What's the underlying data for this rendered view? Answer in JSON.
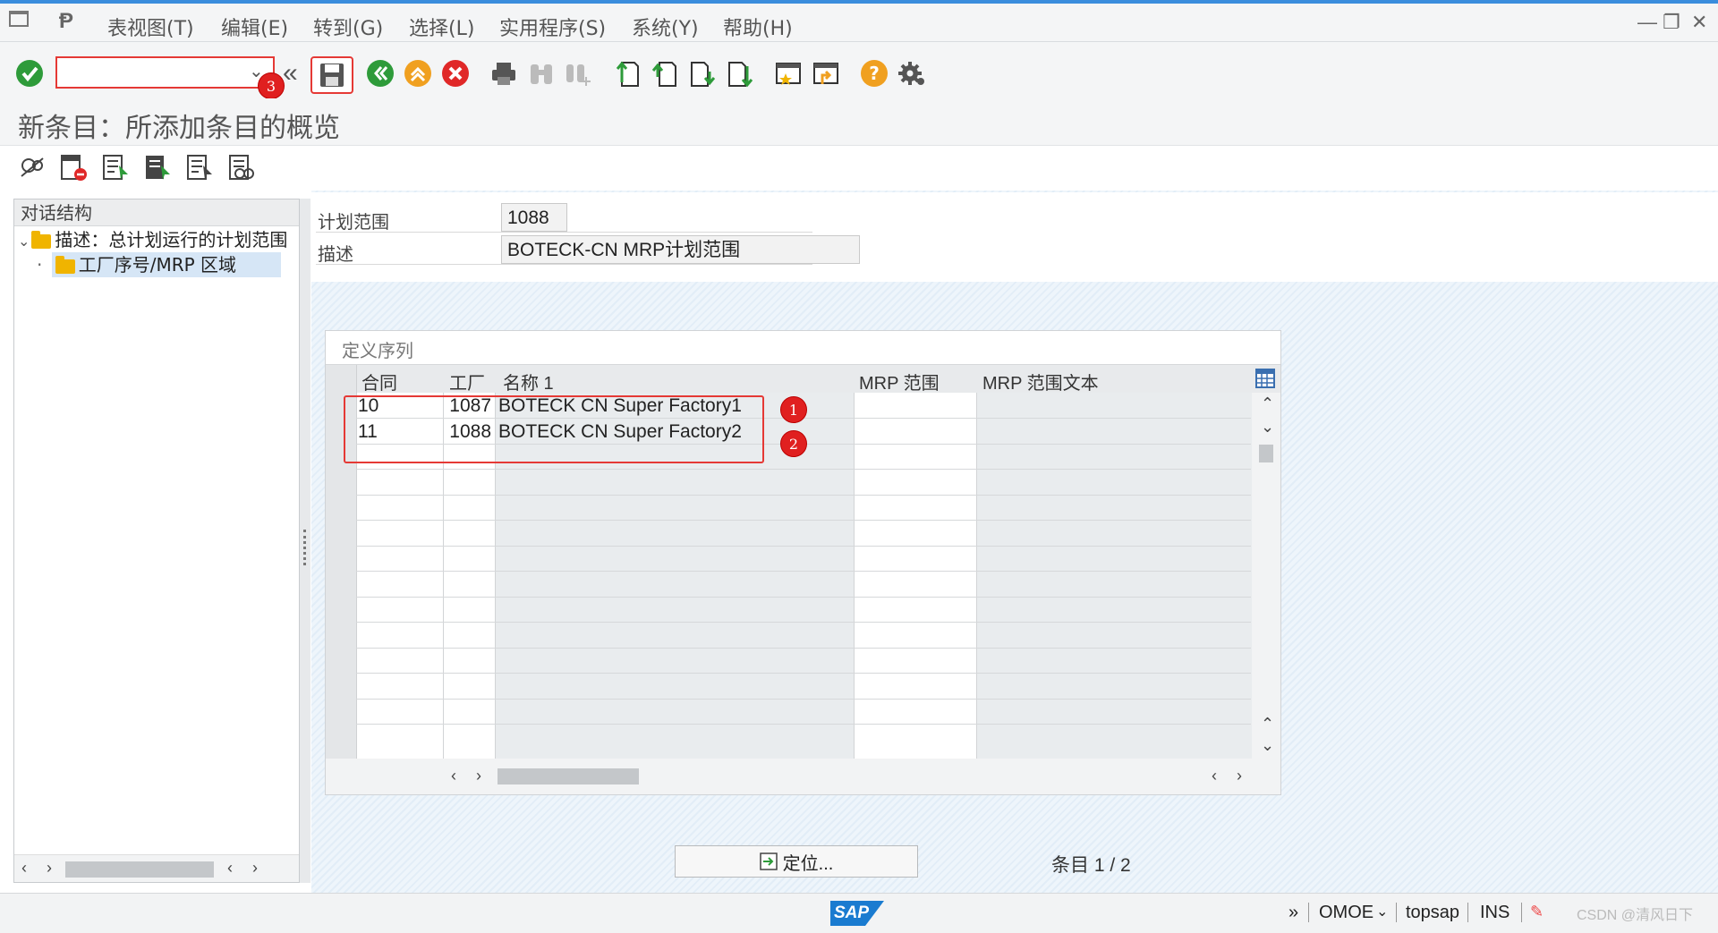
{
  "menu": {
    "items": [
      "表视图(T)",
      "编辑(E)",
      "转到(G)",
      "选择(L)",
      "实用程序(S)",
      "系统(Y)",
      "帮助(H)"
    ]
  },
  "toolbar": {
    "command_value": "",
    "icons": [
      "enter-icon",
      "back-icon",
      "save-icon",
      "back-green-icon",
      "exit-icon",
      "cancel-icon",
      "print-icon",
      "find-icon",
      "find-next-icon",
      "first-page-icon",
      "previous-page-icon",
      "next-page-icon",
      "last-page-icon",
      "new-session-icon",
      "shortcut-icon",
      "help-icon",
      "settings-icon"
    ]
  },
  "annotations": {
    "marker_1": "1",
    "marker_2": "2",
    "marker_3": "3"
  },
  "page": {
    "title": "新条目：所添加条目的概览"
  },
  "tree": {
    "header": "对话结构",
    "root_label": "描述：总计划运行的计划范围",
    "child_label": "工厂序号/MRP 区域"
  },
  "form": {
    "plan_scope_label": "计划范围",
    "plan_scope_value": "1088",
    "desc_label": "描述",
    "desc_value": "BOTECK-CN MRP计划范围"
  },
  "table": {
    "title": "定义序列",
    "columns": [
      "合同",
      "工厂",
      "名称 1",
      "MRP 范围",
      "MRP 范围文本"
    ],
    "rows": [
      {
        "seq": "10",
        "plant": "1087",
        "name": "BOTECK CN Super Factory1",
        "mrp": "",
        "mrp_text": ""
      },
      {
        "seq": "11",
        "plant": "1088",
        "name": "BOTECK CN Super Factory2",
        "mrp": "",
        "mrp_text": ""
      }
    ]
  },
  "footer": {
    "locate_label": "定位...",
    "entry_label": "条目",
    "entry_value": "1 / 2"
  },
  "status": {
    "logo": "SAP",
    "transaction": "OMOE",
    "server": "topsap",
    "mode": "INS",
    "watermark": "CSDN @清风日下"
  },
  "colors": {
    "accent": "#3a8ddd",
    "annotation_red": "#e02020",
    "tree_selected": "#d6e6f6"
  }
}
